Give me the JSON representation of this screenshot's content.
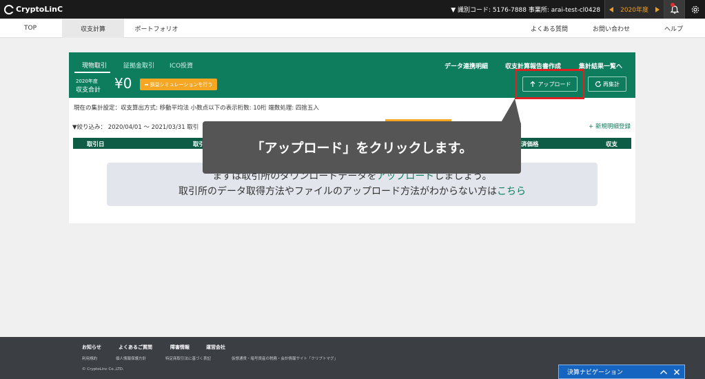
{
  "topbar": {
    "logo": "CryptoLinC",
    "account_info": "▼ 識別コード: 5176-7888  事業所: arai-test-cl0428",
    "year": "2020年度"
  },
  "nav": {
    "items": [
      "TOP",
      "収支計算",
      "ポートフォリオ"
    ],
    "right_items": [
      "よくある質問",
      "お問い合わせ",
      "ヘルプ"
    ]
  },
  "card": {
    "tabs": [
      "現物取引",
      "証拠金取引",
      "ICO投資"
    ],
    "header_links": [
      "データ連携明細",
      "収支計算報告書作成",
      "集計結果一覧へ"
    ],
    "year_small": "2020年度",
    "total_label": "収支合計",
    "total_value": "¥0",
    "sim_button": "➡ 損益シミュレーションを行う",
    "upload_button": "アップロード",
    "recalc_button": "再集計",
    "settings_text": "現在の集計設定：収支算出方式: 移動平均法  小数点以下の表示桁数: 10桁  端数処理: 四捨五入",
    "filter_text": "▼絞り込み： 2020/04/01 〜 2021/03/31 取引",
    "new_register": "+ 新規明細登録",
    "table_headers": [
      "取引日",
      "取引",
      "済価格",
      "収支"
    ],
    "message_line1_a": "まずは取引所のダウンロードデータを",
    "message_line1_link": "アップロード",
    "message_line1_b": "しましょう。",
    "message_line2_a": "取引所のデータ取得方法やファイルのアップロード方法がわからない方は",
    "message_line2_link": "こちら"
  },
  "callout": {
    "text": "「アップロード」をクリックします。"
  },
  "footer": {
    "headings": [
      "お知らせ",
      "よくあるご質問",
      "障害情報",
      "運営会社"
    ],
    "links": [
      "利用規約",
      "個人情報保護方針",
      "特定商取引法に基づく表記",
      "仮想通貨・暗号資産の税務・会計情報サイト「クリプトマグ」"
    ],
    "copyright": "© CryptoLinc Co.,LTD."
  },
  "navi_widget": {
    "label": "決算ナビゲーション"
  },
  "colors": {
    "brand_green": "#0e7d5e",
    "accent_orange": "#f5a623",
    "highlight_red": "#e02020",
    "year_orange": "#f0a020"
  }
}
